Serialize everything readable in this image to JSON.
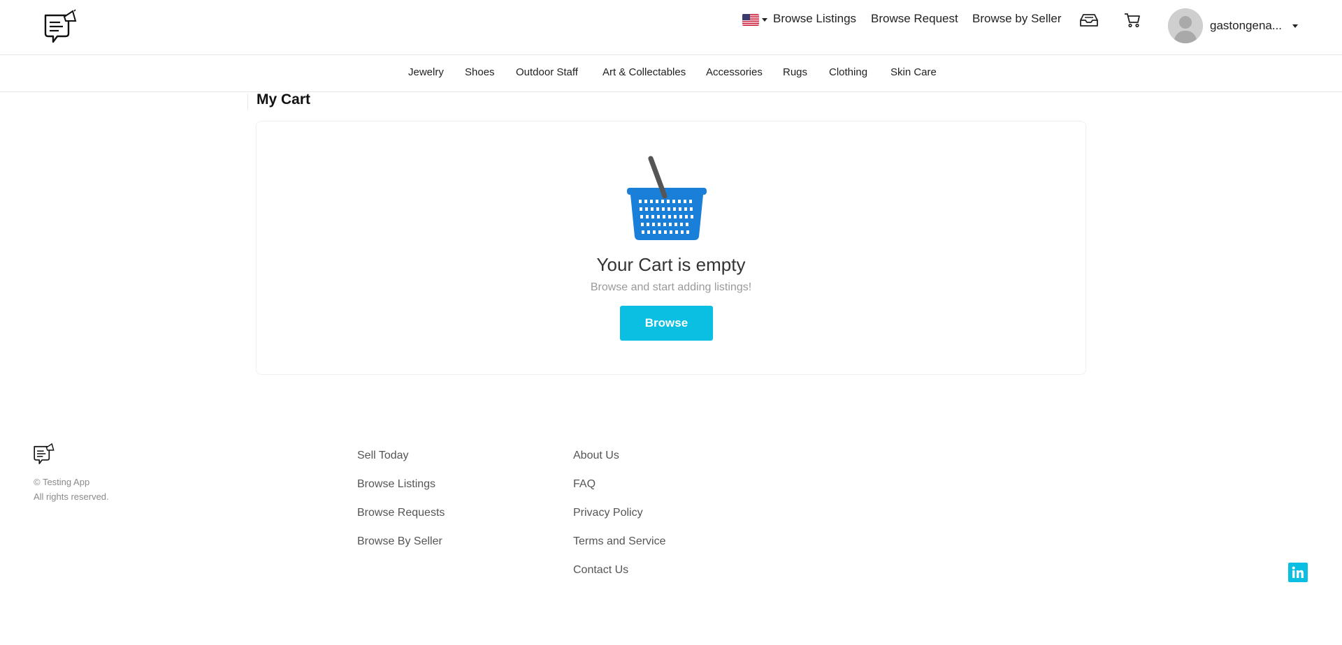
{
  "header": {
    "logo_icon": "chat-megaphone-logo-icon",
    "language_flag_icon": "us-flag-icon",
    "nav": {
      "browse_listings": "Browse Listings",
      "browse_request": "Browse Request",
      "browse_by_seller": "Browse by Seller"
    },
    "inbox_icon": "inbox-tray-icon",
    "cart_icon": "shopping-cart-icon",
    "user": {
      "avatar_icon": "user-avatar-icon",
      "name": "gastongena..."
    }
  },
  "categories": [
    "Jewelry",
    "Shoes",
    "Outdoor Staff",
    "Art & Collectables",
    "Accessories",
    "Rugs",
    "Clothing",
    "Skin Care"
  ],
  "main": {
    "title": "My Cart",
    "empty_state": {
      "icon": "basket-icon",
      "heading": "Your Cart is empty",
      "subtext": "Browse and start adding listings!",
      "button_label": "Browse"
    }
  },
  "footer": {
    "logo_icon": "chat-megaphone-logo-icon",
    "copyright_line1": "© Testing App",
    "copyright_line2": "All rights reserved.",
    "col1": [
      "Sell Today",
      "Browse Listings",
      "Browse Requests",
      "Browse By Seller"
    ],
    "col2": [
      "About Us",
      "FAQ",
      "Privacy Policy",
      "Terms and Service",
      "Contact Us"
    ],
    "social_icon": "linkedin-icon"
  },
  "colors": {
    "accent": "#0bbfe3",
    "basket_blue": "#1a7fd9",
    "basket_handle": "#555555"
  }
}
